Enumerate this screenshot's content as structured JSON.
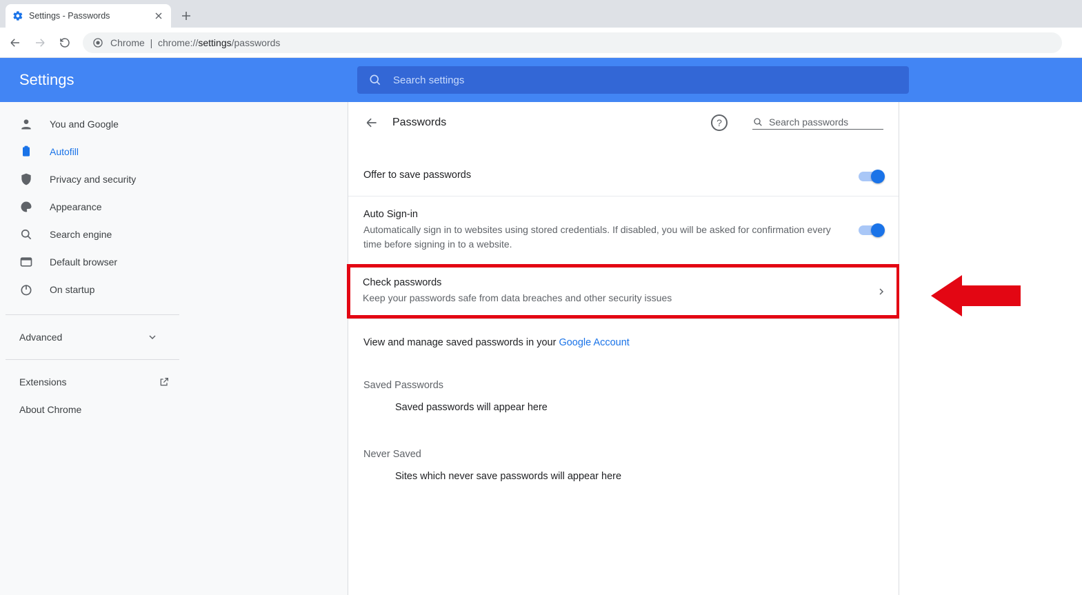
{
  "browser": {
    "tab_title": "Settings - Passwords",
    "url_prefix": "Chrome",
    "url_muted1": "chrome://",
    "url_strong": "settings",
    "url_muted2": "/passwords"
  },
  "header": {
    "title": "Settings",
    "search_placeholder": "Search settings"
  },
  "sidebar": {
    "items": [
      {
        "label": "You and Google"
      },
      {
        "label": "Autofill"
      },
      {
        "label": "Privacy and security"
      },
      {
        "label": "Appearance"
      },
      {
        "label": "Search engine"
      },
      {
        "label": "Default browser"
      },
      {
        "label": "On startup"
      }
    ],
    "advanced": "Advanced",
    "extensions": "Extensions",
    "about": "About Chrome"
  },
  "page": {
    "title": "Passwords",
    "search_placeholder": "Search passwords",
    "offer_save": "Offer to save passwords",
    "auto_signin_title": "Auto Sign-in",
    "auto_signin_desc": "Automatically sign in to websites using stored credentials. If disabled, you will be asked for confirmation every time before signing in to a website.",
    "check_title": "Check passwords",
    "check_desc": "Keep your passwords safe from data breaches and other security issues",
    "manage_prefix": "View and manage saved passwords in your ",
    "manage_link": "Google Account",
    "saved_label": "Saved Passwords",
    "saved_empty": "Saved passwords will appear here",
    "never_label": "Never Saved",
    "never_empty": "Sites which never save passwords will appear here"
  }
}
